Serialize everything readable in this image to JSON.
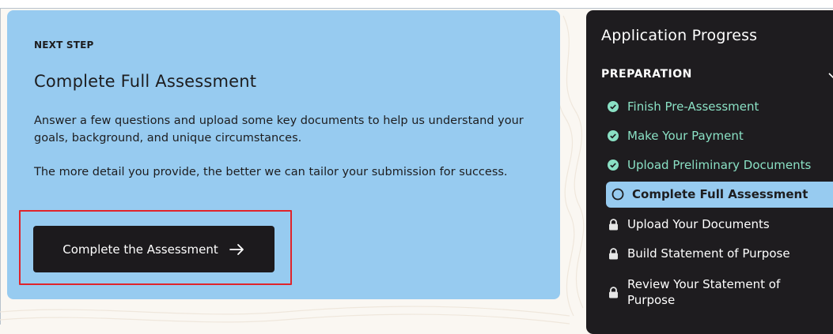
{
  "next_step": {
    "eyebrow": "NEXT STEP",
    "title": "Complete Full Assessment",
    "paragraph_1": "Answer a few questions and upload some key documents to help us understand your goals, background, and unique circumstances.",
    "paragraph_2": "The more detail you provide, the better we can tailor your submission for success.",
    "cta_label": "Complete the Assessment",
    "cta_icon": "arrow-right-icon"
  },
  "progress_panel": {
    "title": "Application Progress",
    "section": "PREPARATION",
    "steps": [
      {
        "label": "Finish Pre-Assessment",
        "status": "done",
        "icon": "check-circle-icon"
      },
      {
        "label": "Make Your Payment",
        "status": "done",
        "icon": "check-circle-icon"
      },
      {
        "label": "Upload Preliminary Documents",
        "status": "done",
        "icon": "check-circle-icon"
      },
      {
        "label": "Complete Full Assessment",
        "status": "current",
        "icon": "circle-outline-icon"
      },
      {
        "label": "Upload Your Documents",
        "status": "locked",
        "icon": "lock-icon"
      },
      {
        "label": "Build Statement of Purpose",
        "status": "locked",
        "icon": "lock-icon"
      },
      {
        "label": "Review Your Statement of Purpose",
        "status": "locked",
        "icon": "lock-icon"
      }
    ]
  },
  "colors": {
    "card_bg": "#97cbf0",
    "panel_bg": "#1e1c1f",
    "done_green": "#8ae0c4",
    "cta_bg": "#1c1a1d",
    "highlight_red": "#e0242b"
  }
}
